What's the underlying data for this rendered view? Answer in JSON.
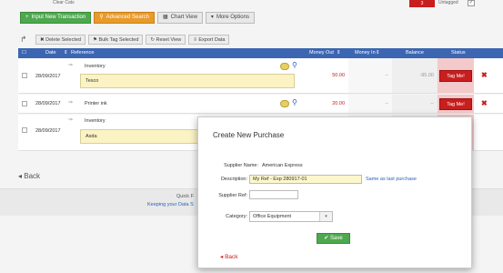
{
  "topbar": {
    "clear_cats": "Clear Cats",
    "red_count": "3",
    "untagged": "Untagged"
  },
  "toolbar": {
    "input_new": "Input New Transaction",
    "advanced_search": "Advanced Search",
    "chart_view": "Chart View",
    "more_options": "More Options"
  },
  "actions": {
    "delete_selected": "Delete Selected",
    "bulk_tag": "Bulk Tag Selected",
    "reset_view": "Reset View",
    "export_data": "Export Data"
  },
  "grid": {
    "headers": {
      "date": "Date",
      "reference": "Reference",
      "money_out": "Money Out",
      "money_in": "Money In",
      "balance": "Balance",
      "status": "Status"
    },
    "rows": [
      {
        "date": "28/09/2017",
        "payee": "Inventory",
        "memo": "Tesco",
        "money_out": "50.00",
        "money_in": "--",
        "balance": "-95.00",
        "tag": "Tag Me!"
      },
      {
        "date": "28/09/2017",
        "payee": "Printer ink",
        "memo": "",
        "money_out": "20.00",
        "money_in": "--",
        "balance": "--",
        "tag": "Tag Me!"
      },
      {
        "date": "28/09/2017",
        "payee": "Inventory",
        "memo": "Asda",
        "money_out": "",
        "money_in": "",
        "balance": "",
        "tag": ""
      }
    ]
  },
  "page": {
    "back": "Back",
    "footer_line1": "Quick F",
    "footer_line2": "Keeping your Data S"
  },
  "modal": {
    "title": "Create New Purchase",
    "supplier_name_label": "Supplier Name:",
    "supplier_name_value": "American Express",
    "description_label": "Description:",
    "description_value": "My Ref - Exp 280917-01",
    "same_as_last": "Same as last purchase",
    "supplier_ref_label": "Supplier Ref:",
    "supplier_ref_value": "",
    "category_label": "Category:",
    "category_value": "Office Equipment",
    "save_label": "Save",
    "back_label": "Back"
  }
}
